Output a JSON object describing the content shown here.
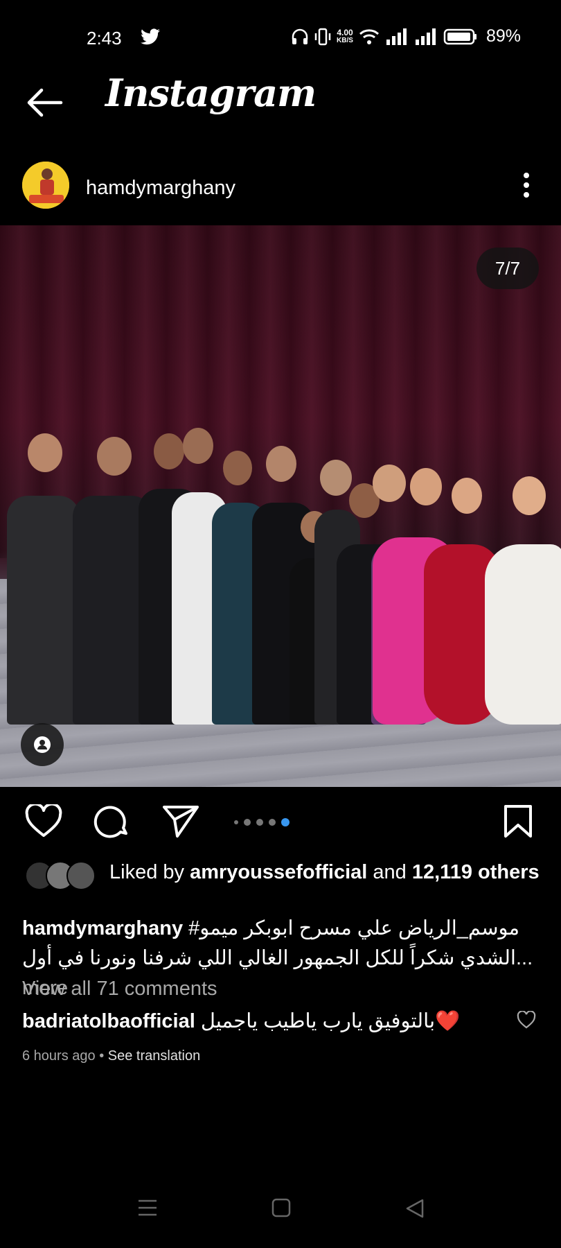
{
  "status_bar": {
    "time": "2:43",
    "net_speed_value": "4.00",
    "net_speed_unit": "KB/S",
    "battery_percent": "89%"
  },
  "header": {
    "title": "Instagram"
  },
  "post": {
    "username": "hamdymarghany",
    "media_counter": "7/7",
    "carousel_total": 5,
    "carousel_active_index": 4
  },
  "likes": {
    "prefix": "Liked by",
    "liker": "amryoussefofficial",
    "connector": "and",
    "others": "12,119 others"
  },
  "caption": {
    "username": "hamdymarghany",
    "line1": "#موسم_الرياض علي مسرح ابوبكر  ميمو",
    "line2": "الشدي شكراً للكل الجمهور الغالي اللي شرفنا ونورنا في أول...",
    "more": "more"
  },
  "comments": {
    "view_all": "View all 71 comments",
    "top_comment": {
      "username": "badriatolbaofficial",
      "text": "بالتوفيق يارب ياطيب ياجميل❤️"
    },
    "time_ago": "6 hours ago",
    "separator": "•",
    "see_translation": "See translation"
  },
  "colors": {
    "background": "#000000",
    "accent": "#3897f0",
    "muted_text": "#a8a8a8"
  },
  "icons": [
    "twitter-icon",
    "headphones-icon",
    "vibrate-icon",
    "wifi-icon",
    "signal-icon",
    "battery-icon",
    "back-arrow-icon",
    "more-vertical-icon",
    "person-tag-icon",
    "heart-icon",
    "comment-icon",
    "share-icon",
    "bookmark-icon",
    "menu-icon",
    "home-icon",
    "back-icon"
  ]
}
